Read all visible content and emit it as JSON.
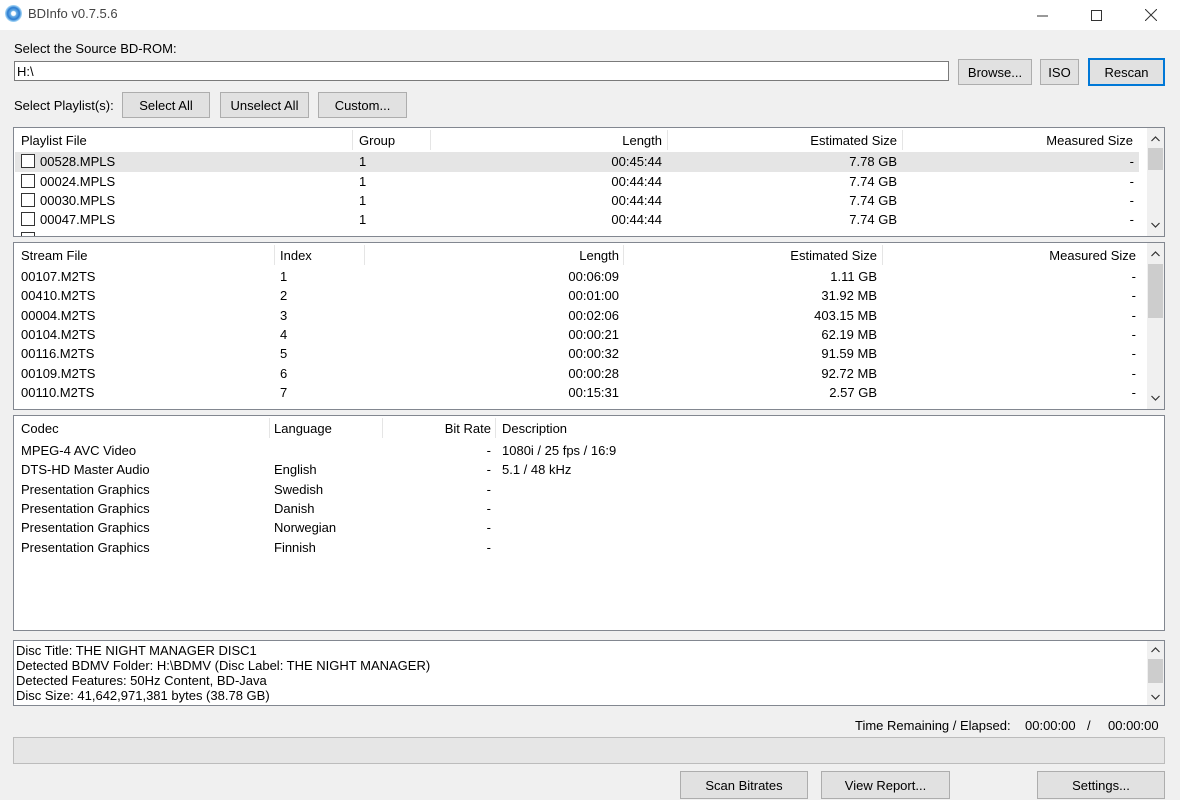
{
  "window": {
    "title": "BDInfo v0.7.5.6"
  },
  "source": {
    "label": "Select the Source BD-ROM:",
    "path": "H:\\",
    "browse_label": "Browse...",
    "iso_label": "ISO",
    "rescan_label": "Rescan"
  },
  "playlist_select": {
    "label": "Select Playlist(s):",
    "select_all": "Select All",
    "unselect_all": "Unselect All",
    "custom": "Custom..."
  },
  "playlists": {
    "headers": [
      "Playlist File",
      "Group",
      "Length",
      "Estimated Size",
      "Measured Size"
    ],
    "rows": [
      {
        "file": "00528.MPLS",
        "group": "1",
        "length": "00:45:44",
        "est": "7.78 GB",
        "measured": "-"
      },
      {
        "file": "00024.MPLS",
        "group": "1",
        "length": "00:44:44",
        "est": "7.74 GB",
        "measured": "-"
      },
      {
        "file": "00030.MPLS",
        "group": "1",
        "length": "00:44:44",
        "est": "7.74 GB",
        "measured": "-"
      },
      {
        "file": "00047.MPLS",
        "group": "1",
        "length": "00:44:44",
        "est": "7.74 GB",
        "measured": "-"
      }
    ]
  },
  "streams": {
    "headers": [
      "Stream File",
      "Index",
      "Length",
      "Estimated Size",
      "Measured Size"
    ],
    "rows": [
      {
        "file": "00107.M2TS",
        "index": "1",
        "length": "00:06:09",
        "est": "1.11 GB",
        "measured": "-"
      },
      {
        "file": "00410.M2TS",
        "index": "2",
        "length": "00:01:00",
        "est": "31.92 MB",
        "measured": "-"
      },
      {
        "file": "00004.M2TS",
        "index": "3",
        "length": "00:02:06",
        "est": "403.15 MB",
        "measured": "-"
      },
      {
        "file": "00104.M2TS",
        "index": "4",
        "length": "00:00:21",
        "est": "62.19 MB",
        "measured": "-"
      },
      {
        "file": "00116.M2TS",
        "index": "5",
        "length": "00:00:32",
        "est": "91.59 MB",
        "measured": "-"
      },
      {
        "file": "00109.M2TS",
        "index": "6",
        "length": "00:00:28",
        "est": "92.72 MB",
        "measured": "-"
      },
      {
        "file": "00110.M2TS",
        "index": "7",
        "length": "00:15:31",
        "est": "2.57 GB",
        "measured": "-"
      }
    ]
  },
  "codecs": {
    "headers": [
      "Codec",
      "Language",
      "Bit Rate",
      "Description"
    ],
    "rows": [
      {
        "codec": "MPEG-4 AVC Video",
        "language": "",
        "bitrate": "-",
        "desc": "1080i / 25 fps / 16:9"
      },
      {
        "codec": "DTS-HD Master Audio",
        "language": "English",
        "bitrate": "-",
        "desc": "5.1 / 48 kHz"
      },
      {
        "codec": "Presentation Graphics",
        "language": "Swedish",
        "bitrate": "-",
        "desc": ""
      },
      {
        "codec": "Presentation Graphics",
        "language": "Danish",
        "bitrate": "-",
        "desc": ""
      },
      {
        "codec": "Presentation Graphics",
        "language": "Norwegian",
        "bitrate": "-",
        "desc": ""
      },
      {
        "codec": "Presentation Graphics",
        "language": "Finnish",
        "bitrate": "-",
        "desc": ""
      }
    ]
  },
  "info": {
    "lines": [
      "Disc Title: THE NIGHT MANAGER DISC1",
      "Detected BDMV Folder: H:\\BDMV (Disc Label: THE NIGHT MANAGER)",
      "Detected Features: 50Hz Content, BD-Java",
      "Disc Size: 41,642,971,381 bytes (38.78 GB)"
    ]
  },
  "status": {
    "label": "Time Remaining / Elapsed:",
    "remaining": "00:00:00",
    "separator": "/",
    "elapsed": "00:00:00",
    "progress": 0
  },
  "actions": {
    "scan_bitrates": "Scan Bitrates",
    "view_report": "View Report...",
    "settings": "Settings..."
  }
}
